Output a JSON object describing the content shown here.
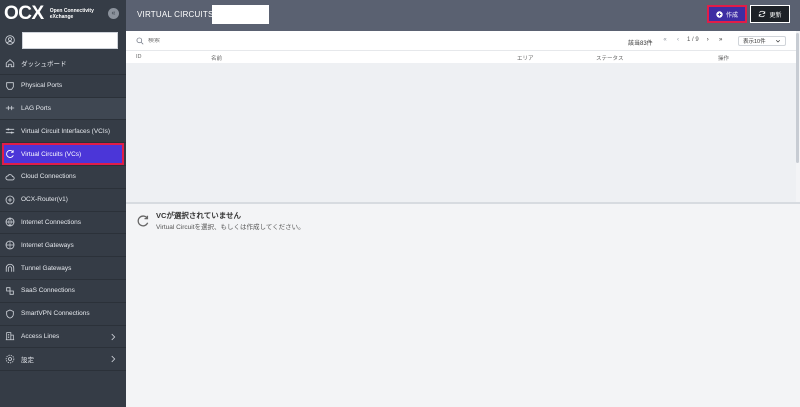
{
  "brand": {
    "logo": "OCX",
    "line1": "Open Connectivity",
    "line2": "eXchange",
    "collapse": "«"
  },
  "header": {
    "title": "VIRTUAL CIRCUITS",
    "create_label": "作成",
    "refresh_label": "更新"
  },
  "sidebar": {
    "items": [
      {
        "label": "ダッシュボード"
      },
      {
        "label": "Physical Ports"
      },
      {
        "label": "LAG Ports"
      },
      {
        "label": "Virtual Circuit Interfaces (VCIs)"
      },
      {
        "label": "Virtual Circuits (VCs)"
      },
      {
        "label": "Cloud Connections"
      },
      {
        "label": "OCX-Router(v1)"
      },
      {
        "label": "Internet Connections"
      },
      {
        "label": "Internet Gateways"
      },
      {
        "label": "Tunnel Gateways"
      },
      {
        "label": "SaaS Connections"
      },
      {
        "label": "SmartVPN Connections"
      },
      {
        "label": "Access Lines"
      },
      {
        "label": "設定"
      }
    ]
  },
  "toolbar": {
    "search_placeholder": "検索",
    "count": "該当83件",
    "page": "1 / 9",
    "page_size": "表示10件"
  },
  "table": {
    "headers": [
      "ID",
      "名前",
      "エリア",
      "ステータス",
      "操作"
    ],
    "rows": []
  },
  "detail": {
    "title": "VCが選択されていません",
    "description": "Virtual Circuitを選択、もしくは作成してください。"
  },
  "colors": {
    "sidebar": "#353c46",
    "header": "#5a6171",
    "accent": "#4b36d8",
    "highlight": "#e11d48"
  }
}
